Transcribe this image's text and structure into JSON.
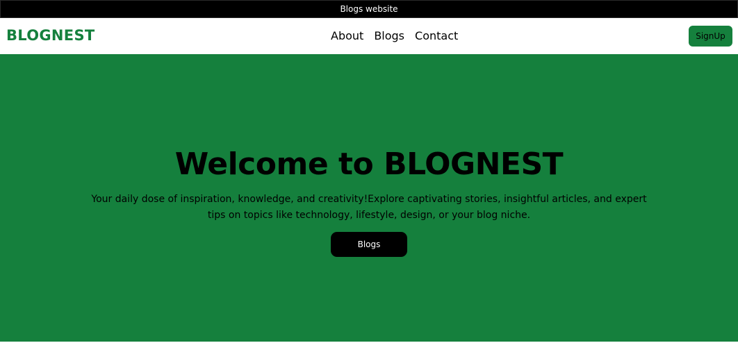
{
  "topbar": {
    "title": "Blogs website"
  },
  "navbar": {
    "logo": "BLOGNEST",
    "links": [
      "About",
      "Blogs",
      "Contact"
    ],
    "signup_label": "SignUp"
  },
  "hero": {
    "title": "Welcome to BLOGNEST",
    "subtitle": "Your daily dose of inspiration, knowledge, and creativity!Explore captivating stories, insightful articles, and expert tips on topics like technology, lifestyle, design, or your blog niche.",
    "button_label": "Blogs"
  },
  "colors": {
    "brand_green": "#15803d",
    "black": "#000000",
    "white": "#ffffff"
  }
}
